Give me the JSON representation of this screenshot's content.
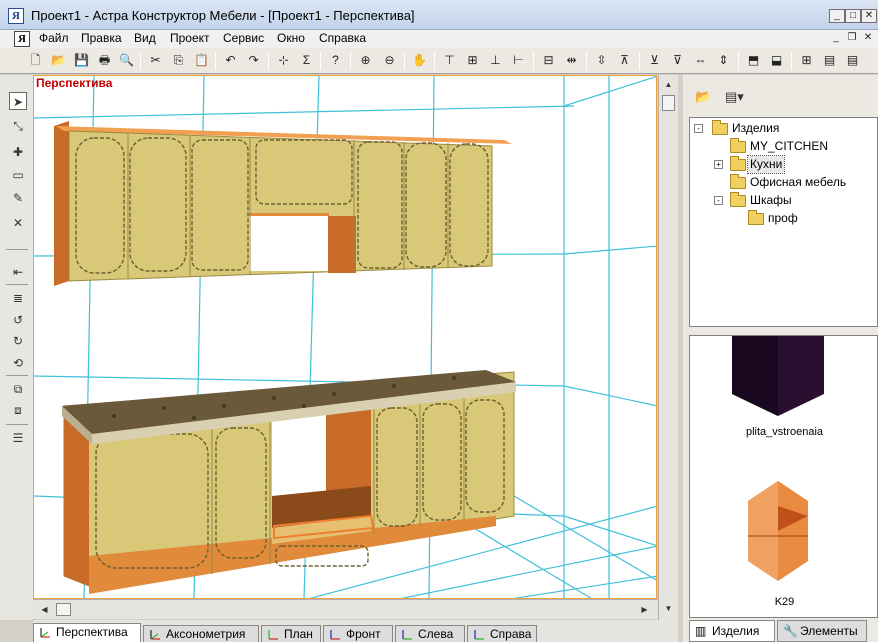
{
  "window": {
    "title": "Проект1 - Астра Конструктор Мебели - [Проект1 - Перспектива]",
    "icon_glyph": "Я",
    "min_label": "_",
    "max_label": "□",
    "close_label": "✕"
  },
  "menu": {
    "items": [
      "Файл",
      "Правка",
      "Вид",
      "Проект",
      "Сервис",
      "Окно",
      "Справка"
    ],
    "mdi_min": "_",
    "mdi_restore": "❐",
    "mdi_close": "✕"
  },
  "toolbar": {
    "buttons": [
      {
        "icon": "new-doc-icon",
        "glyph": "🗋"
      },
      {
        "icon": "open-folder-icon",
        "glyph": "📂"
      },
      {
        "icon": "save-icon",
        "glyph": "💾"
      },
      {
        "icon": "print-icon",
        "glyph": "🖶"
      },
      {
        "icon": "print-preview-icon",
        "glyph": "🔍"
      },
      {
        "icon": "cut-icon",
        "glyph": "✂"
      },
      {
        "icon": "copy-icon",
        "glyph": "⎘"
      },
      {
        "icon": "paste-icon",
        "glyph": "📋"
      },
      {
        "icon": "undo-icon",
        "glyph": "↶"
      },
      {
        "icon": "redo-icon",
        "glyph": "↷"
      },
      {
        "icon": "hierarchy-icon",
        "glyph": "⊹"
      },
      {
        "icon": "sum-icon",
        "glyph": "Σ"
      },
      {
        "icon": "help-pointer-icon",
        "glyph": "?"
      },
      {
        "icon": "zoom-in-icon",
        "glyph": "⊕"
      },
      {
        "icon": "zoom-out-icon",
        "glyph": "⊖"
      },
      {
        "icon": "pan-hand-icon",
        "glyph": "✋"
      },
      {
        "icon": "align-top-icon",
        "glyph": "⊤"
      },
      {
        "icon": "align-middle-icon",
        "glyph": "⊞"
      },
      {
        "icon": "align-bottom-icon",
        "glyph": "⊥"
      },
      {
        "icon": "align-left-icon",
        "glyph": "⊢"
      },
      {
        "icon": "align-center-icon",
        "glyph": "⊟"
      },
      {
        "icon": "distribute-h-icon",
        "glyph": "⇹"
      },
      {
        "icon": "distribute-v-icon",
        "glyph": "⇳"
      },
      {
        "icon": "snap-top-icon",
        "glyph": "⊼"
      },
      {
        "icon": "snap-middle-icon",
        "glyph": "⊻"
      },
      {
        "icon": "snap-bottom-icon",
        "glyph": "⊽"
      },
      {
        "icon": "spacing-h-icon",
        "glyph": "⇔"
      },
      {
        "icon": "spacing-v-icon",
        "glyph": "⇕"
      },
      {
        "icon": "move-up-icon",
        "glyph": "⬒"
      },
      {
        "icon": "move-down-icon",
        "glyph": "⬓"
      },
      {
        "icon": "grid-icon",
        "glyph": "⊞"
      },
      {
        "icon": "layout-icon",
        "glyph": "▤"
      }
    ]
  },
  "left_tools": [
    {
      "icon": "select-arrow-icon",
      "glyph": "➤"
    },
    {
      "icon": "rotate-select-icon",
      "glyph": "⤡"
    },
    {
      "icon": "add-item-icon",
      "glyph": "✚"
    },
    {
      "icon": "rectangle-icon",
      "glyph": "▭"
    },
    {
      "icon": "eraser-icon",
      "glyph": "✎"
    },
    {
      "icon": "delete-icon",
      "glyph": "✕"
    },
    {
      "icon": "split-h-icon",
      "glyph": "⇤"
    },
    {
      "icon": "align-tool-icon",
      "glyph": "≣"
    },
    {
      "icon": "rotate-left-icon",
      "glyph": "↺"
    },
    {
      "icon": "rotate-right-icon",
      "glyph": "↻"
    },
    {
      "icon": "rotate-z-icon",
      "glyph": "⟲"
    },
    {
      "icon": "group-icon",
      "glyph": "⧉"
    },
    {
      "icon": "ungroup-icon",
      "glyph": "⧈"
    },
    {
      "icon": "properties-icon",
      "glyph": "☰"
    }
  ],
  "viewport": {
    "label": "Перспектива",
    "colors": {
      "grid": "#40c0d8",
      "cabinet": "#d8c878",
      "carcass": "#e08a3a",
      "countertop": "#6a5a3a"
    }
  },
  "tabs": [
    {
      "label": "Перспектива",
      "icon": "perspective-view-icon"
    },
    {
      "label": "Аксонометрия",
      "icon": "axonometric-view-icon"
    },
    {
      "label": "План",
      "icon": "plan-view-icon"
    },
    {
      "label": "Фронт",
      "icon": "front-view-icon"
    },
    {
      "label": "Слева",
      "icon": "left-view-icon"
    },
    {
      "label": "Справа",
      "icon": "right-view-icon"
    }
  ],
  "right_panel": {
    "tree": [
      {
        "label": "Изделия",
        "level": 0,
        "toggle": "-"
      },
      {
        "label": "MY_CITCHEN",
        "level": 1,
        "toggle": ""
      },
      {
        "label": "Кухни",
        "level": 1,
        "toggle": "+"
      },
      {
        "label": "Офисная мебель",
        "level": 1,
        "toggle": ""
      },
      {
        "label": "Шкафы",
        "level": 1,
        "toggle": "-"
      },
      {
        "label": "проф",
        "level": 2,
        "toggle": ""
      }
    ],
    "previews": [
      {
        "label": "plita_vstroenaia"
      },
      {
        "label": "K29"
      }
    ],
    "tabs": [
      {
        "label": "Изделия",
        "icon": "products-icon"
      },
      {
        "label": "Элементы",
        "icon": "elements-icon"
      }
    ]
  }
}
